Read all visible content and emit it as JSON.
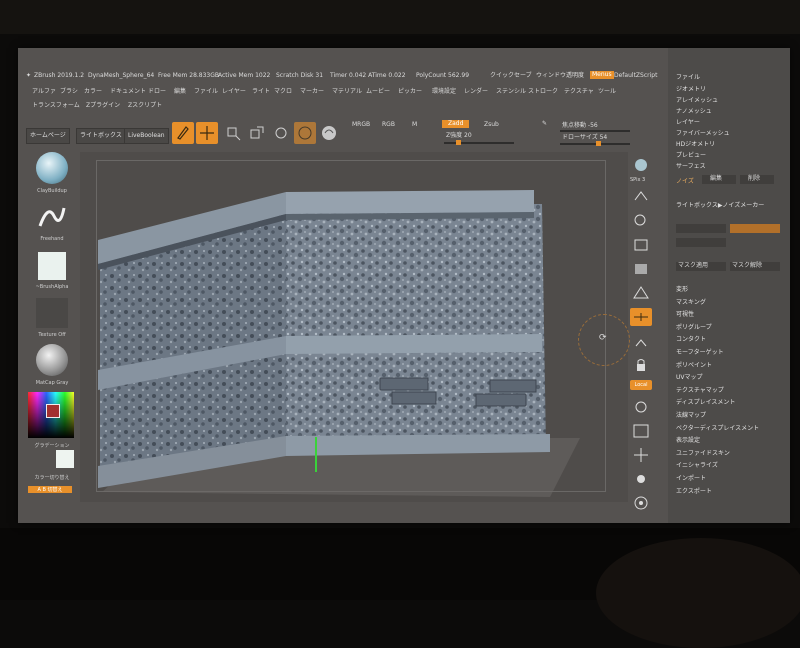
{
  "status": {
    "version": "ZBrush 2019.1.2",
    "mesh": "DynaMesh_Sphere_64",
    "free_mem": "Free Mem 28.833GB",
    "active_mem": "Active Mem 1022",
    "scratch": "Scratch Disk 31",
    "timer": "Timer 0.042 ATime 0.022",
    "polycount": "PolyCount 562.99",
    "quicksave": "クイックセーブ",
    "transparency": "ウィンドウ透明度",
    "menus_btn": "Menus",
    "script": "DefaultZScript",
    "right_top": "ファイル"
  },
  "menubar": {
    "row1": [
      "アルファ",
      "ブラシ",
      "カラー",
      "ドキュメント",
      "ドロー",
      "編集",
      "ファイル",
      "レイヤー",
      "ライト",
      "マクロ",
      "マーカー",
      "マテリアル",
      "ムービー",
      "ピッカー",
      "環境設定",
      "レンダー",
      "ステンシル",
      "ストローク",
      "テクスチャ",
      "ツール"
    ],
    "row2": [
      "トランスフォーム",
      "Zプラグイン",
      "Zスクリプト"
    ]
  },
  "toolbar": {
    "home": "ホームページ",
    "lightbox": "ライトボックス",
    "livebool": "LiveBoolean",
    "mrgb": "MRGB",
    "rgb": "RGB",
    "m": "M",
    "zadd": "Zadd",
    "zsub": "Zsub",
    "zint_label": "Z強度 20",
    "focal_label": "焦点移動 -56",
    "draw_size_label": "ドローサイズ 54",
    "zint_level": 0.2,
    "draw_size_level": 0.54
  },
  "left_shelf": {
    "brush": "ClayBuildup",
    "stroke": "Freehand",
    "alpha": "~BrushAlpha",
    "texture": "Texture Off",
    "material": "MatCap Gray",
    "gradient": "グラデーション",
    "color_switch": "カラー切り替え",
    "ab_switch": "A B 切替え"
  },
  "right_shelf": {
    "spix": "SPix 3",
    "local": "Local"
  },
  "panel": {
    "items_top": [
      "ジオメトリ",
      "アレイメッシュ",
      "ナノメッシュ",
      "レイヤー",
      "ファイバーメッシュ",
      "HDジオメトリ",
      "プレビュー",
      "サーフェス"
    ],
    "noise": "ノイズ",
    "edit": "編集",
    "delete": "削除",
    "lightbox_noise": "ライトボックス▶ノイズメーカー",
    "mask_apply": "マスク適用",
    "mask_release": "マスク解除",
    "items_bottom": [
      "変形",
      "マスキング",
      "可視性",
      "ポリグループ",
      "コンタクト",
      "モーフターゲット",
      "ポリペイント",
      "UVマップ",
      "テクスチャマップ",
      "ディスプレイスメント",
      "法線マップ",
      "ベクターディスプレイスメント",
      "表示設定",
      "ユニファイドスキン",
      "イニシャライズ",
      "インポート",
      "エクスポート"
    ]
  },
  "colors": {
    "accent": "#e8902a",
    "panel_bg": "#4d4b49",
    "screen_bg": "#555250"
  }
}
